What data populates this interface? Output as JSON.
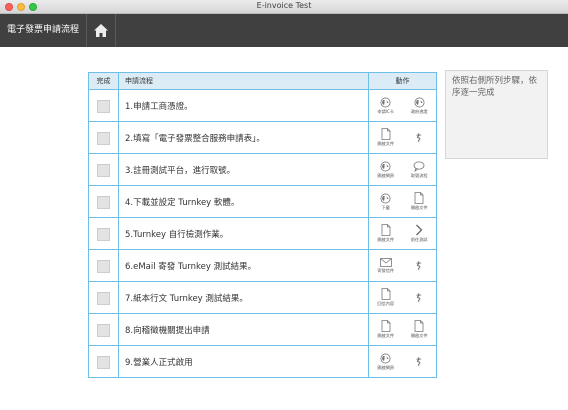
{
  "window": {
    "title": "E-invoice Test"
  },
  "nav": {
    "brand": "電子發票申請流程"
  },
  "table": {
    "headers": {
      "done": "完成",
      "step": "申請流程",
      "actions": "動作"
    }
  },
  "steps": [
    {
      "label": "1.申請工商憑證。",
      "actions": [
        {
          "icon": "globe-icon",
          "label": "申請IC卡"
        },
        {
          "icon": "globe-icon",
          "label": "政府憑證"
        }
      ]
    },
    {
      "label": "2.填寫「電子發票整合服務申請表」。",
      "actions": [
        {
          "icon": "document-icon",
          "label": "開啟文件"
        },
        {
          "icon": "signature-icon",
          "label": ""
        }
      ]
    },
    {
      "label": "3.註冊測試平台，進行取號。",
      "actions": [
        {
          "icon": "globe-icon",
          "label": "開啟網頁"
        },
        {
          "icon": "chat-bubble-icon",
          "label": "取號流程"
        }
      ]
    },
    {
      "label": "4.下載並設定 Turnkey 軟體。",
      "actions": [
        {
          "icon": "globe-icon",
          "label": "下載"
        },
        {
          "icon": "document-icon",
          "label": "開啟文件"
        }
      ]
    },
    {
      "label": "5.Turnkey 自行檢測作業。",
      "actions": [
        {
          "icon": "document-icon",
          "label": "開啟文件"
        },
        {
          "icon": "chevron-right-icon",
          "label": "前往測試"
        }
      ]
    },
    {
      "label": "6.eMail 寄發 Turnkey 測試結果。",
      "actions": [
        {
          "icon": "envelope-icon",
          "label": "寄發信件"
        },
        {
          "icon": "signature-icon",
          "label": ""
        }
      ]
    },
    {
      "label": "7.紙本行文 Turnkey 測試結果。",
      "actions": [
        {
          "icon": "document-icon",
          "label": "回信內容"
        },
        {
          "icon": "signature-icon",
          "label": ""
        }
      ]
    },
    {
      "label": "8.向稽徵機關提出申請",
      "actions": [
        {
          "icon": "document-icon",
          "label": "開啟文件"
        },
        {
          "icon": "document-icon",
          "label": "開啟文件"
        }
      ]
    },
    {
      "label": "9.營業人正式啟用",
      "actions": [
        {
          "icon": "globe-icon",
          "label": "開啟網頁"
        },
        {
          "icon": "signature-icon",
          "label": ""
        }
      ]
    }
  ],
  "note": {
    "text": "依照右側所列步驟，依序逐一完成"
  },
  "colors": {
    "nav_bg": "#404040",
    "table_border": "#6ebfe8",
    "header_bg": "#dcecf7"
  }
}
